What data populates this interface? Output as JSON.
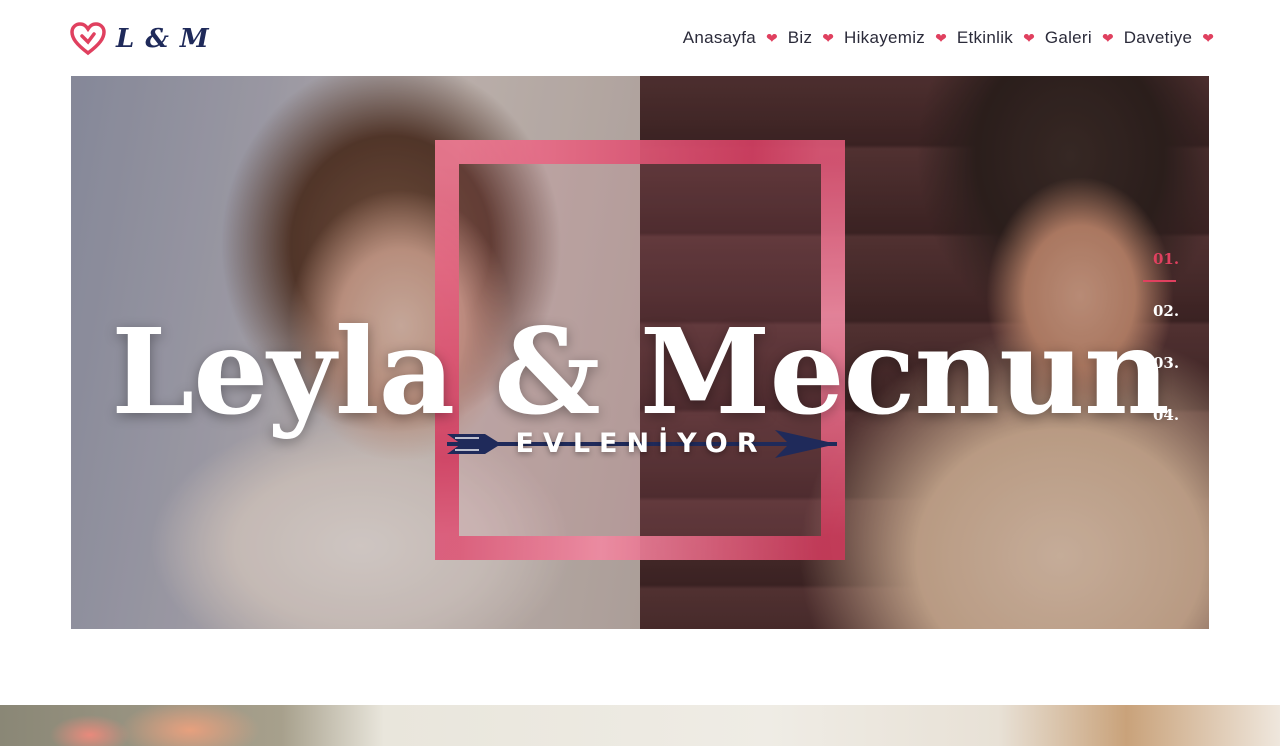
{
  "brand": {
    "text": "L & M"
  },
  "nav": {
    "items": [
      {
        "label": "Anasayfa"
      },
      {
        "label": "Biz"
      },
      {
        "label": "Hikayemiz"
      },
      {
        "label": "Etkinlik"
      },
      {
        "label": "Galeri"
      },
      {
        "label": "Davetiye"
      }
    ],
    "separator_icon": "heart-icon"
  },
  "hero": {
    "title": "Leyla & Mecnun",
    "subtitle": "EVLENİYOR",
    "slides": [
      {
        "label": "01.",
        "active": true
      },
      {
        "label": "02.",
        "active": false
      },
      {
        "label": "03.",
        "active": false
      },
      {
        "label": "04.",
        "active": false
      }
    ]
  },
  "colors": {
    "accent": "#e0405f",
    "brand_navy": "#1f2a5a",
    "frame_pink": "#e05a78",
    "text_dark": "#2b2b3a"
  }
}
